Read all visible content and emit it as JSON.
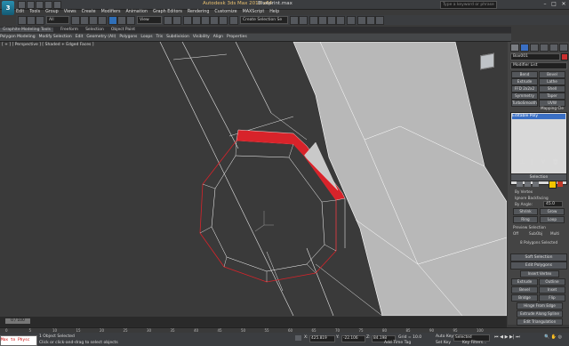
{
  "title_bar": {
    "app_title": "Autodesk 3ds Max 2012 x64",
    "file_name": "Blueprint.max",
    "search_placeholder": "Type a keyword or phrase"
  },
  "menu": [
    "Edit",
    "Tools",
    "Group",
    "Views",
    "Create",
    "Modifiers",
    "Animation",
    "Graph Editors",
    "Rendering",
    "Customize",
    "MAXScript",
    "Help"
  ],
  "toolbar": {
    "selection_filter": "All",
    "reference_coord": "View",
    "named_selection": "Create Selection Se"
  },
  "ribbon": {
    "tabs": [
      "Graphite Modeling Tools",
      "Freeform",
      "Selection",
      "Object Paint"
    ],
    "subtabs": [
      "Polygon Modeling",
      "Modify Selection",
      "Edit",
      "Geometry (All)",
      "Polygons",
      "Loops",
      "Tris",
      "Subdivision",
      "Visibility",
      "Align",
      "Properties"
    ]
  },
  "viewport": {
    "label": "[ + ] [ Perspective ] [ Shaded + Edged Faces ]"
  },
  "command_panel": {
    "object_name": "Box001",
    "modifier_list": "Modifier List",
    "modifier_buttons": [
      "Bend",
      "Bevel",
      "Extrude",
      "Lathe",
      "FFD 2x2x2",
      "Shell",
      "Symmetry",
      "Taper",
      "TurboSmooth",
      "UVW Mapping Cle"
    ],
    "stack_item": "Editable Poly",
    "selection": {
      "header": "Selection",
      "by_vertex": "By Vertex",
      "ignore_backfacing": "Ignore Backfacing",
      "by_angle": "By Angle:",
      "angle_value": "45.0",
      "shrink": "Shrink",
      "grow": "Grow",
      "ring": "Ring",
      "loop": "Loop",
      "preview_label": "Preview Selection",
      "preview_off": "Off",
      "preview_subobj": "SubObj",
      "preview_multi": "Multi",
      "selected_count": "8 Polygons Selected"
    },
    "soft_selection": "Soft Selection",
    "edit_polygons": {
      "header": "Edit Polygons",
      "insert_vertex": "Insert Vertex",
      "extrude": "Extrude",
      "outline": "Outline",
      "bevel": "Bevel",
      "inset": "Inset",
      "bridge": "Bridge",
      "flip": "Flip",
      "hinge": "Hinge From Edge",
      "extrude_spline": "Extrude Along Spline",
      "edit_triangulation": "Edit Triangulation"
    }
  },
  "timeline": {
    "slider": "0 / 100",
    "ticks": [
      "0",
      "5",
      "10",
      "15",
      "20",
      "25",
      "30",
      "35",
      "40",
      "45",
      "50",
      "55",
      "60",
      "65",
      "70",
      "75",
      "80",
      "85",
      "90",
      "95",
      "100"
    ]
  },
  "status": {
    "maxscript": "Max to Physc",
    "objects_selected": "1 Object Selected",
    "prompt": "Click or click-and-drag to select objects",
    "x": "425.819",
    "y": "-22.106",
    "z": "84.198",
    "grid": "Grid = 10.0",
    "add_time_tag": "Add Time Tag",
    "auto_key": "Auto Key",
    "set_key": "Set Key",
    "key_mode": "Selected",
    "key_filters": "Key Filters..."
  },
  "colors": {
    "selection_red": "#d8232a",
    "viewport_bg": "#3a3a3a"
  }
}
